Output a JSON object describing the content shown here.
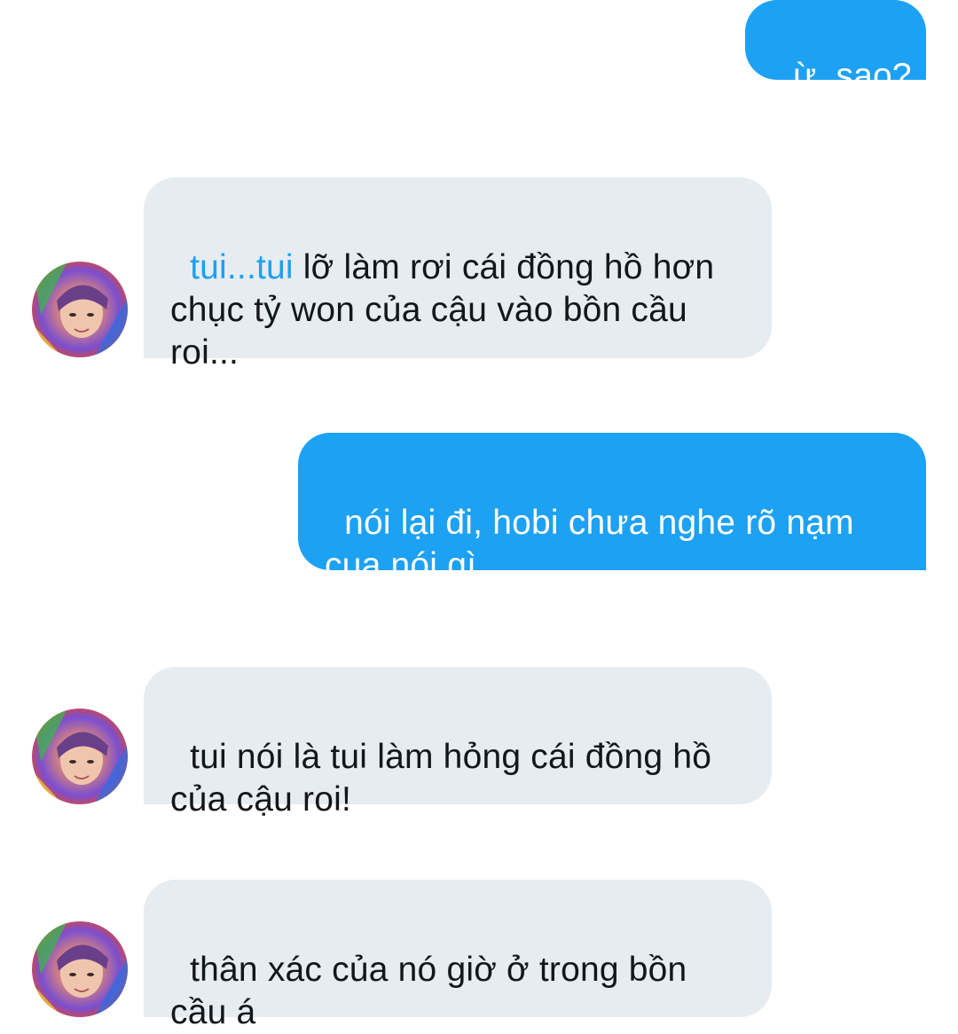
{
  "conversation": {
    "messages": [
      {
        "side": "outgoing",
        "text": "ừ, sao?"
      },
      {
        "side": "incoming",
        "mention": "tui...tui",
        "text": " lỡ làm rơi cái đồng hồ hơn chục tỷ won của cậu vào bồn cầu roi..."
      },
      {
        "side": "outgoing",
        "text": "nói lại đi, hobi chưa nghe rõ nạm cua nói gì"
      },
      {
        "side": "incoming",
        "text": "tui nói là tui làm hỏng cái đồng hồ của cậu roi!"
      },
      {
        "side": "incoming",
        "text": "thân xác của nó giờ ở trong bồn cầu á"
      }
    ]
  },
  "colors": {
    "outgoing_bubble": "#1da1f2",
    "incoming_bubble": "#e6ecf0",
    "mention": "#1da1f2",
    "incoming_text": "#14171a",
    "outgoing_text": "#ffffff"
  },
  "avatar": {
    "icon": "profile-photo-avatar"
  }
}
